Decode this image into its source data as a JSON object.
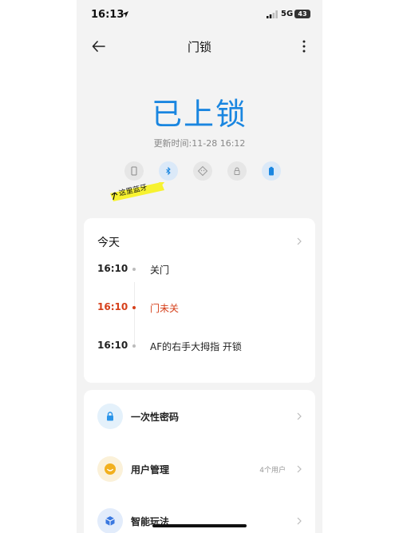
{
  "status_bar": {
    "time": "16:13",
    "network": "5G",
    "battery": "43"
  },
  "header": {
    "title": "门锁"
  },
  "lock": {
    "status": "已上锁",
    "update_time": "更新时间:11-28 16:12"
  },
  "annotation": {
    "text": "这里蓝牙"
  },
  "status_icons": [
    "phone-icon",
    "bluetooth-icon",
    "face-icon",
    "lock-icon",
    "battery-icon"
  ],
  "today": {
    "title": "今天",
    "logs": [
      {
        "time": "16:10",
        "text": "关门"
      },
      {
        "time": "16:10",
        "text": "门未关"
      },
      {
        "time": "16:10",
        "text": "AF的右手大拇指 开锁"
      }
    ]
  },
  "menu": {
    "items": [
      {
        "label": "一次性密码",
        "icon": "lock-icon",
        "extra": ""
      },
      {
        "label": "用户管理",
        "icon": "smile-icon",
        "extra": "4个用户"
      },
      {
        "label": "智能玩法",
        "icon": "cube-icon",
        "extra": ""
      }
    ]
  },
  "colors": {
    "accent": "#1a86e0",
    "alert": "#d6401b",
    "annotation": "#f7f230"
  }
}
